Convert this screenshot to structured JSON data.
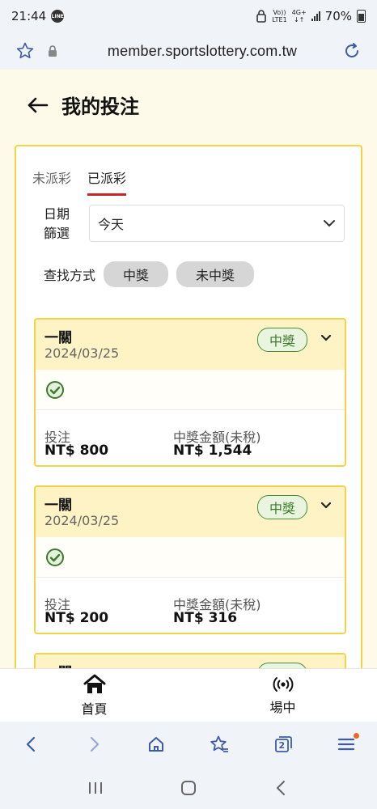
{
  "status_bar": {
    "time": "21:44",
    "line_badge": "LINE",
    "volte_top": "Vo))",
    "volte_bottom": "LTE1",
    "network_top": "4G+",
    "network_bottom": "↓↑",
    "battery": "70%"
  },
  "browser": {
    "url": "member.sportslottery.com.tw"
  },
  "page": {
    "title": "我的投注",
    "tabs": [
      {
        "label": "未派彩",
        "active": false
      },
      {
        "label": "已派彩",
        "active": true
      }
    ],
    "date_filter_label": "日期篩選",
    "date_filter_value": "今天",
    "search_label": "查找方式",
    "search_chips": [
      "中獎",
      "未中獎"
    ]
  },
  "bets": [
    {
      "title": "一關",
      "date": "2024/03/25",
      "badge": "中獎",
      "stake_label": "投注",
      "stake_value": "NT$ 800",
      "win_label": "中獎金額(未稅)",
      "win_value": "NT$ 1,544"
    },
    {
      "title": "一關",
      "date": "2024/03/25",
      "badge": "中獎",
      "stake_label": "投注",
      "stake_value": "NT$ 200",
      "win_label": "中獎金額(未稅)",
      "win_value": "NT$ 316"
    },
    {
      "title": "一關",
      "badge": "中獎"
    }
  ],
  "bottom_nav": [
    {
      "label": "首頁",
      "icon": "home-icon"
    },
    {
      "label": "場中",
      "icon": "live-icon"
    }
  ],
  "browser_bar": {
    "tab_count": "2"
  },
  "colors": {
    "accent_yellow": "#f3d34a",
    "header_bg": "#fdf3c4",
    "win_green": "#3d7a2b",
    "active_tab_underline": "#c62828",
    "page_bg": "#fdfaea"
  }
}
